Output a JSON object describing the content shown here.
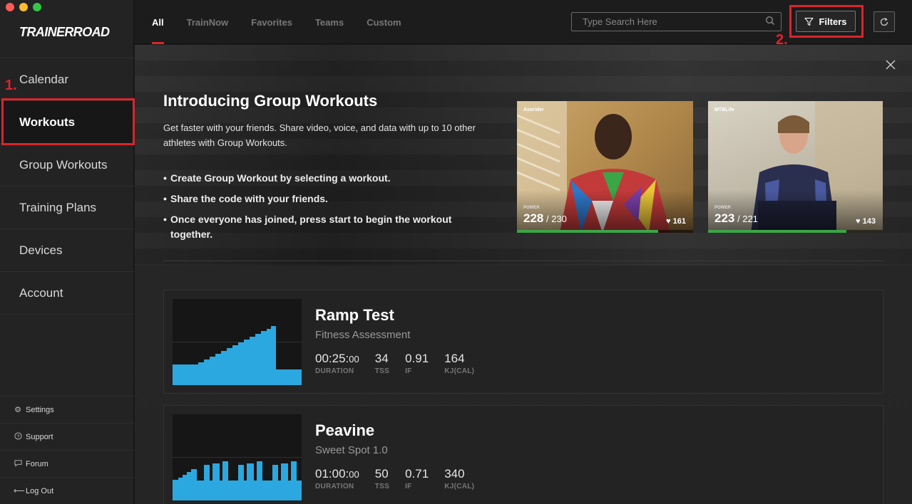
{
  "app": {
    "logo": "TRAINERROAD"
  },
  "sidebar": {
    "items": [
      {
        "label": "Calendar"
      },
      {
        "label": "Workouts"
      },
      {
        "label": "Group Workouts"
      },
      {
        "label": "Training Plans"
      },
      {
        "label": "Devices"
      },
      {
        "label": "Account"
      }
    ],
    "bottom": [
      {
        "label": "Settings",
        "icon": "gear-icon"
      },
      {
        "label": "Support",
        "icon": "question-icon"
      },
      {
        "label": "Forum",
        "icon": "chat-icon"
      },
      {
        "label": "Log Out",
        "icon": "arrow-left-icon"
      }
    ]
  },
  "annotations": {
    "one": "1.",
    "two": "2."
  },
  "tabs": [
    {
      "label": "All"
    },
    {
      "label": "TrainNow"
    },
    {
      "label": "Favorites"
    },
    {
      "label": "Teams"
    },
    {
      "label": "Custom"
    }
  ],
  "search": {
    "placeholder": "Type Search Here"
  },
  "toolbar": {
    "filters_label": "Filters"
  },
  "promo": {
    "title": "Introducing Group Workouts",
    "description": "Get faster with your friends. Share video, voice, and data with up to 10 other athletes with Group Workouts.",
    "bullets": [
      "Create Group Workout by selecting a workout.",
      "Share the code with your friends.",
      "Once everyone has joined, press start to begin the workout together."
    ],
    "videos": [
      {
        "name": "Asorider",
        "power_label": "POWER",
        "power": "228",
        "target": "230",
        "hr": "161",
        "progress": 0.8
      },
      {
        "name": "MTBLife",
        "power_label": "POWER",
        "power": "223",
        "target": "221",
        "hr": "143",
        "progress": 0.79
      }
    ]
  },
  "workouts": [
    {
      "title": "Ramp Test",
      "subtitle": "Fitness Assessment",
      "duration_main": "00:25:",
      "duration_sec": "00",
      "tss": "34",
      "if": "0.91",
      "kj": "164",
      "labels": {
        "duration": "DURATION",
        "tss": "TSS",
        "if": "IF",
        "kj": "KJ(CAL)"
      }
    },
    {
      "title": "Peavine",
      "subtitle": "Sweet Spot 1.0",
      "duration_main": "01:00:",
      "duration_sec": "00",
      "tss": "50",
      "if": "0.71",
      "kj": "340",
      "labels": {
        "duration": "DURATION",
        "tss": "TSS",
        "if": "IF",
        "kj": "KJ(CAL)"
      }
    }
  ],
  "colors": {
    "accent": "#d8262c",
    "graph": "#2ba8e0",
    "progress": "#3aa646"
  }
}
